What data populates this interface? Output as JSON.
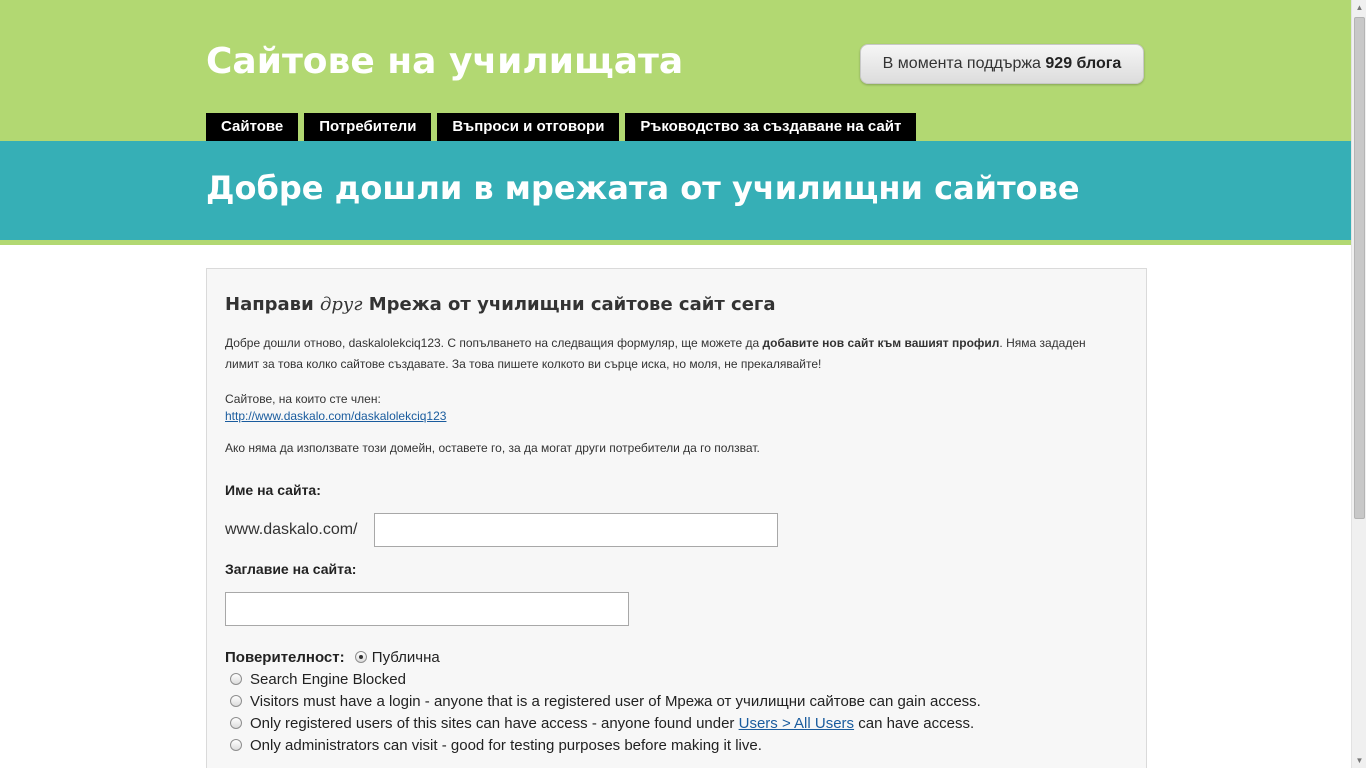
{
  "header": {
    "site_title": "Сайтове на училищата",
    "counter_prefix": "В момента поддържа",
    "counter_value": "929 блога"
  },
  "nav": {
    "items": [
      "Сайтове",
      "Потребители",
      "Въпроси и отговори",
      "Ръководство за създаване на сайт"
    ]
  },
  "banner": {
    "title": "Добре дошли в мрежата от училищни сайтове"
  },
  "form": {
    "heading_before": "Направи",
    "heading_italic": "друг",
    "heading_after": "Мрежа от училищни сайтове сайт сега",
    "intro_part1": "Добре дошли отново, daskalolekciq123. С попълването на следващия формуляр, ще можете да",
    "intro_bold": "добавите нов сайт към вашият профил",
    "intro_part2": ". Няма зададен лимит за това колко сайтове създавате. За това пишете колкото ви сърце иска, но моля, не прекалявайте!",
    "member_label": "Сайтове, на които сте член:",
    "member_link": "http://www.daskalo.com/daskalolekciq123",
    "note": "Ако няма да използвате този домейн, оставете го, за да могат други потребители да го ползват.",
    "site_name_label": "Име на сайта:",
    "site_name_prefix": "www.daskalo.com/",
    "site_name_value": "",
    "site_title_label": "Заглавие на сайта:",
    "site_title_value": "",
    "privacy_label": "Поверителност:",
    "privacy_options": [
      "Публична",
      "Search Engine Blocked",
      "Visitors must have a login - anyone that is a registered user of Мрежа от училищни сайтове can gain access.",
      "Only registered users of this sites can have access - anyone found under",
      "Only administrators can visit - good for testing purposes before making it live."
    ],
    "privacy_option4_link": "Users > All Users",
    "privacy_option4_suffix": "can have access.",
    "privacy_selected": 0
  }
}
